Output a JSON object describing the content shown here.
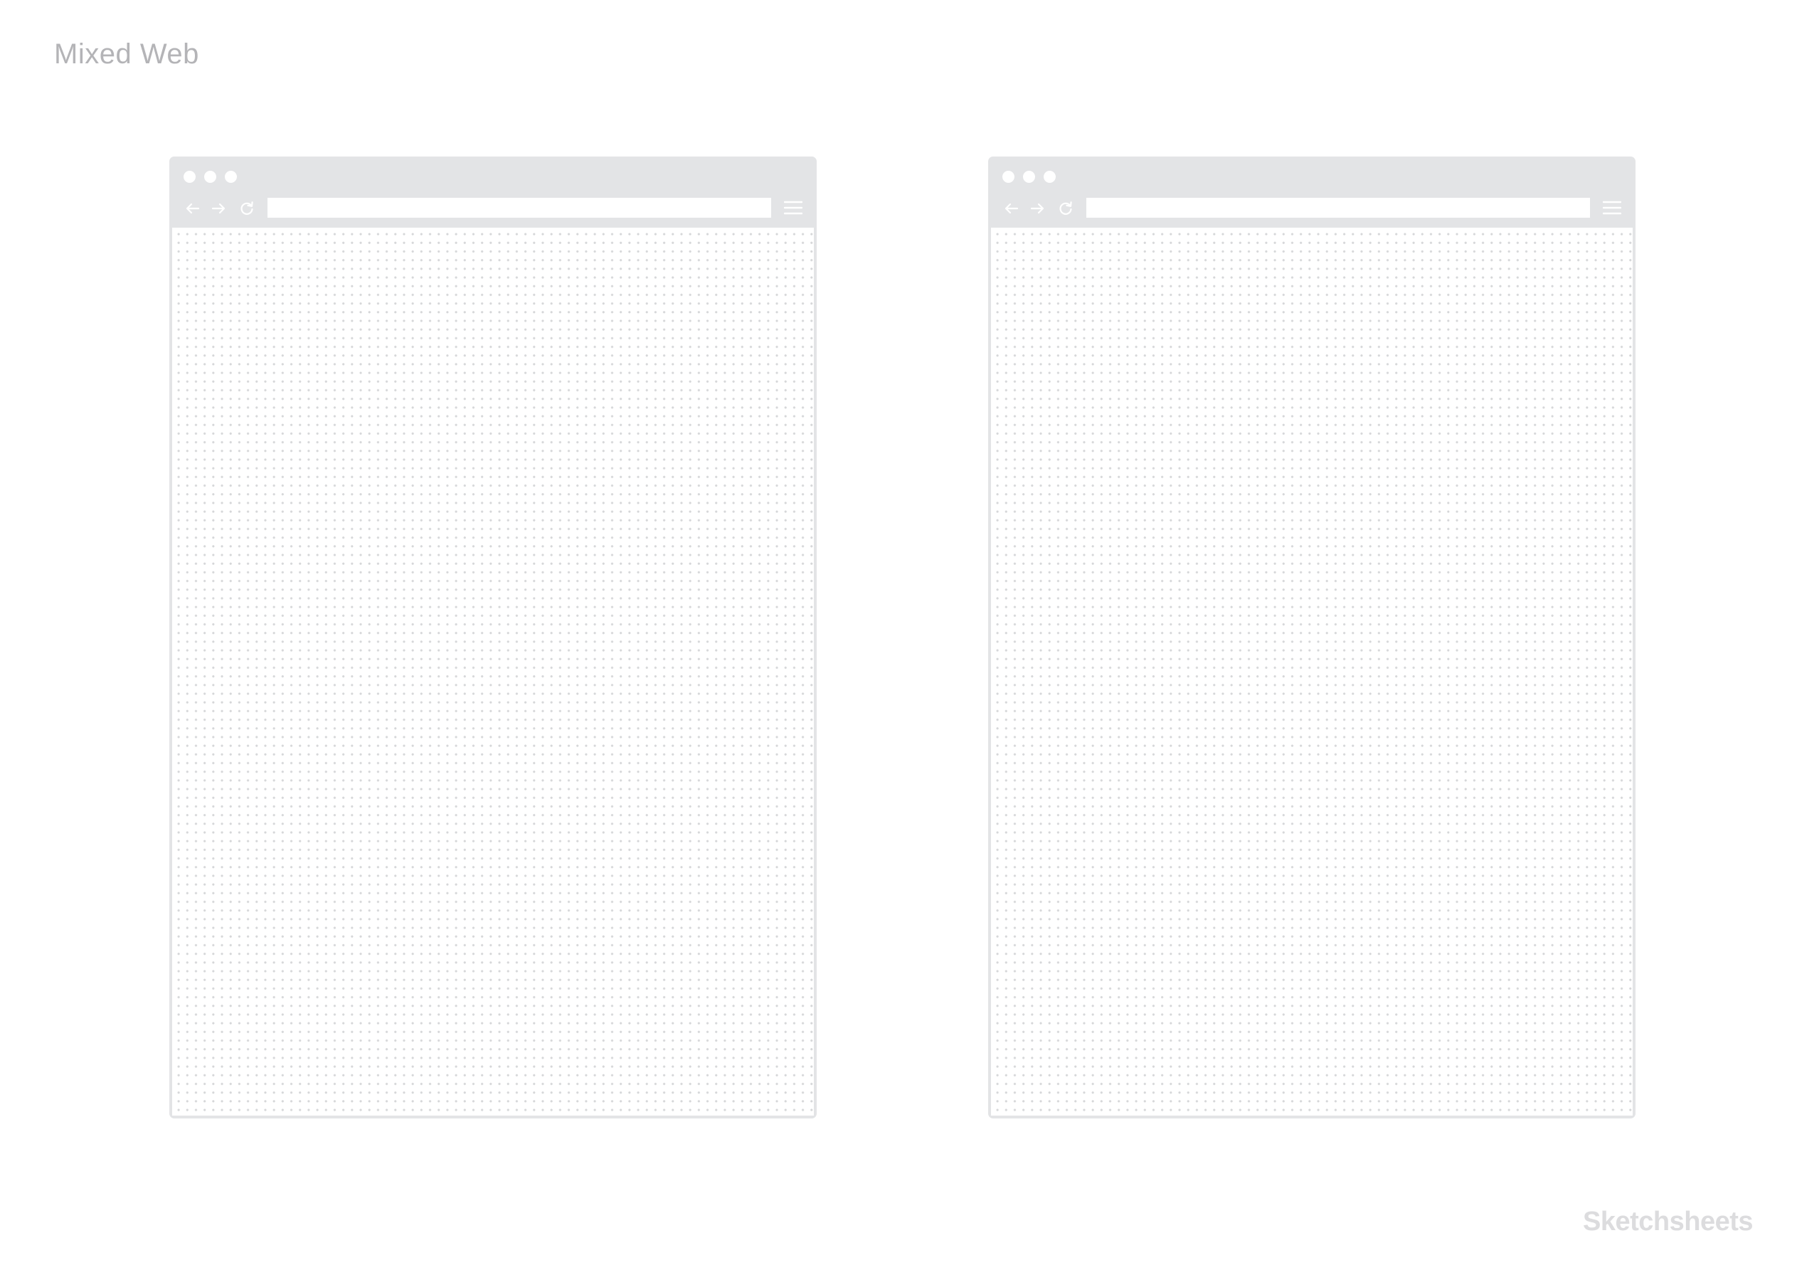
{
  "sheet": {
    "title": "Mixed Web",
    "brand": "Sketchsheets"
  },
  "browsers": [
    {
      "address_value": "",
      "icons": [
        "back-arrow-icon",
        "forward-arrow-icon",
        "reload-icon",
        "hamburger-menu-icon"
      ]
    },
    {
      "address_value": "",
      "icons": [
        "back-arrow-icon",
        "forward-arrow-icon",
        "reload-icon",
        "hamburger-menu-icon"
      ]
    }
  ],
  "colors": {
    "frame": "#e3e4e6",
    "title_text": "#b4b4b7",
    "brand_text": "#dcdcde",
    "grid_dot": "#d6d7d9"
  }
}
